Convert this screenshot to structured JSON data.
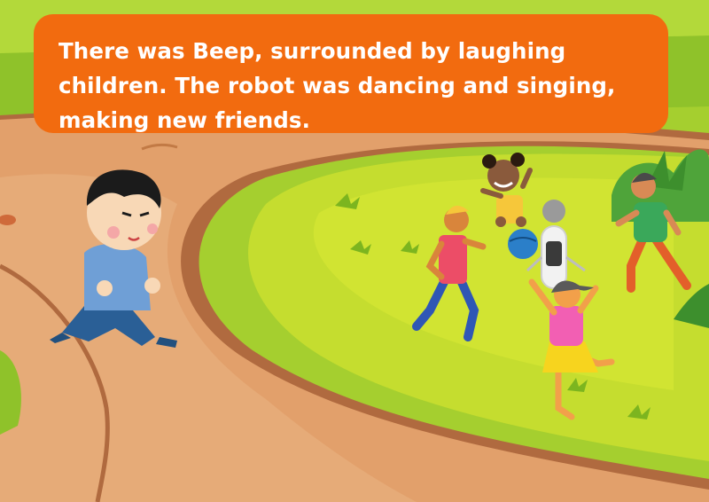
{
  "story": {
    "caption": "There was Beep, surrounded by laughing children. The robot was dancing and singing, making new friends."
  },
  "colors": {
    "caption_bg": "#f26b0f",
    "grass": "#9ccb2c",
    "path": "#e2a06b",
    "path_edge": "#b06a3f"
  },
  "characters": [
    "running-boy",
    "robot-beep",
    "dancing-girl",
    "cheering-toddler",
    "running-child-left",
    "running-child-right"
  ]
}
